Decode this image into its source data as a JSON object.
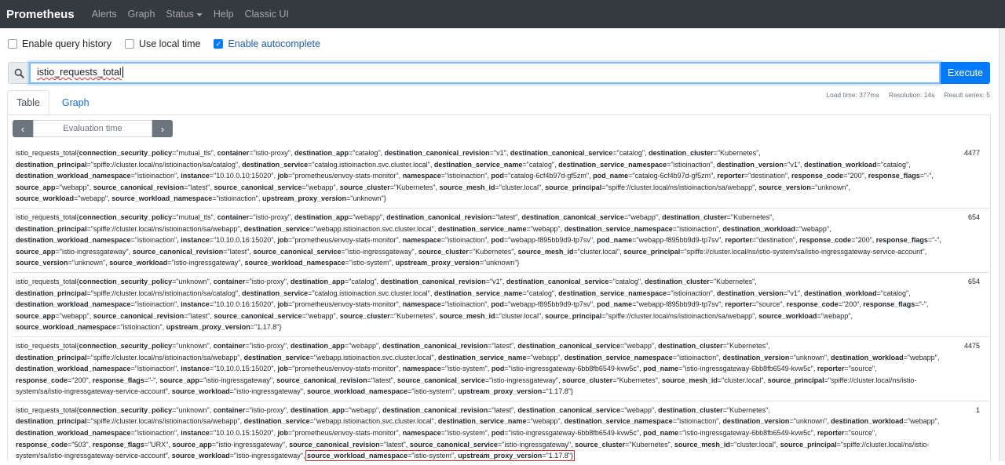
{
  "nav": {
    "brand": "Prometheus",
    "items": [
      "Alerts",
      "Graph",
      "Status",
      "Help",
      "Classic UI"
    ]
  },
  "options": {
    "query_history": "Enable query history",
    "local_time": "Use local time",
    "autocomplete": "Enable autocomplete"
  },
  "query": {
    "value": "istio_requests_total",
    "execute_label": "Execute"
  },
  "tabs": {
    "table": "Table",
    "graph": "Graph"
  },
  "stats": {
    "load_time": "Load time: 377ms",
    "resolution": "Resolution: 14s",
    "series": "Result series: 5"
  },
  "eval": {
    "label": "Evaluation time"
  },
  "results": [
    {
      "name": "istio_requests_total",
      "value": "4477",
      "labels": [
        [
          "connection_security_policy",
          "mutual_tls"
        ],
        [
          "container",
          "istio-proxy"
        ],
        [
          "destination_app",
          "catalog"
        ],
        [
          "destination_canonical_revision",
          "v1"
        ],
        [
          "destination_canonical_service",
          "catalog"
        ],
        [
          "destination_cluster",
          "Kubernetes"
        ],
        [
          "destination_principal",
          "spiffe://cluster.local/ns/istioinaction/sa/catalog"
        ],
        [
          "destination_service",
          "catalog.istioinaction.svc.cluster.local"
        ],
        [
          "destination_service_name",
          "catalog"
        ],
        [
          "destination_service_namespace",
          "istioinaction"
        ],
        [
          "destination_version",
          "v1"
        ],
        [
          "destination_workload",
          "catalog"
        ],
        [
          "destination_workload_namespace",
          "istioinaction"
        ],
        [
          "instance",
          "10.10.0.10:15020"
        ],
        [
          "job",
          "prometheus/envoy-stats-monitor"
        ],
        [
          "namespace",
          "istioinaction"
        ],
        [
          "pod",
          "catalog-6cf4b97d-gf5zm"
        ],
        [
          "pod_name",
          "catalog-6cf4b97d-gf5zm"
        ],
        [
          "reporter",
          "destination"
        ],
        [
          "response_code",
          "200"
        ],
        [
          "response_flags",
          "-"
        ],
        [
          "source_app",
          "webapp"
        ],
        [
          "source_canonical_revision",
          "latest"
        ],
        [
          "source_canonical_service",
          "webapp"
        ],
        [
          "source_cluster",
          "Kubernetes"
        ],
        [
          "source_mesh_id",
          "cluster.local"
        ],
        [
          "source_principal",
          "spiffe://cluster.local/ns/istioinaction/sa/webapp"
        ],
        [
          "source_version",
          "unknown"
        ],
        [
          "source_workload",
          "webapp"
        ],
        [
          "source_workload_namespace",
          "istioinaction"
        ],
        [
          "upstream_proxy_version",
          "unknown"
        ]
      ]
    },
    {
      "name": "istio_requests_total",
      "value": "654",
      "labels": [
        [
          "connection_security_policy",
          "mutual_tls"
        ],
        [
          "container",
          "istio-proxy"
        ],
        [
          "destination_app",
          "webapp"
        ],
        [
          "destination_canonical_revision",
          "latest"
        ],
        [
          "destination_canonical_service",
          "webapp"
        ],
        [
          "destination_cluster",
          "Kubernetes"
        ],
        [
          "destination_principal",
          "spiffe://cluster.local/ns/istioinaction/sa/webapp"
        ],
        [
          "destination_service",
          "webapp.istioinaction.svc.cluster.local"
        ],
        [
          "destination_service_name",
          "webapp"
        ],
        [
          "destination_service_namespace",
          "istioinaction"
        ],
        [
          "destination_workload",
          "webapp"
        ],
        [
          "destination_workload_namespace",
          "istioinaction"
        ],
        [
          "instance",
          "10.10.0.16:15020"
        ],
        [
          "job",
          "prometheus/envoy-stats-monitor"
        ],
        [
          "namespace",
          "istioinaction"
        ],
        [
          "pod",
          "webapp-f895bb9d9-tp7sv"
        ],
        [
          "pod_name",
          "webapp-f895bb9d9-tp7sv"
        ],
        [
          "reporter",
          "destination"
        ],
        [
          "response_code",
          "200"
        ],
        [
          "response_flags",
          "-"
        ],
        [
          "source_app",
          "istio-ingressgateway"
        ],
        [
          "source_canonical_revision",
          "latest"
        ],
        [
          "source_canonical_service",
          "istio-ingressgateway"
        ],
        [
          "source_cluster",
          "Kubernetes"
        ],
        [
          "source_mesh_id",
          "cluster.local"
        ],
        [
          "source_principal",
          "spiffe://cluster.local/ns/istio-system/sa/istio-ingressgateway-service-account"
        ],
        [
          "source_version",
          "unknown"
        ],
        [
          "source_workload",
          "istio-ingressgateway"
        ],
        [
          "source_workload_namespace",
          "istio-system"
        ],
        [
          "upstream_proxy_version",
          "unknown"
        ]
      ]
    },
    {
      "name": "istio_requests_total",
      "value": "654",
      "labels": [
        [
          "connection_security_policy",
          "unknown"
        ],
        [
          "container",
          "istio-proxy"
        ],
        [
          "destination_app",
          "catalog"
        ],
        [
          "destination_canonical_revision",
          "v1"
        ],
        [
          "destination_canonical_service",
          "catalog"
        ],
        [
          "destination_cluster",
          "Kubernetes"
        ],
        [
          "destination_principal",
          "spiffe://cluster.local/ns/istioinaction/sa/catalog"
        ],
        [
          "destination_service",
          "catalog.istioinaction.svc.cluster.local"
        ],
        [
          "destination_service_name",
          "catalog"
        ],
        [
          "destination_service_namespace",
          "istioinaction"
        ],
        [
          "destination_version",
          "v1"
        ],
        [
          "destination_workload",
          "catalog"
        ],
        [
          "destination_workload_namespace",
          "istioinaction"
        ],
        [
          "instance",
          "10.10.0.16:15020"
        ],
        [
          "job",
          "prometheus/envoy-stats-monitor"
        ],
        [
          "namespace",
          "istioinaction"
        ],
        [
          "pod",
          "webapp-f895bb9d9-tp7sv"
        ],
        [
          "pod_name",
          "webapp-f895bb9d9-tp7sv"
        ],
        [
          "reporter",
          "source"
        ],
        [
          "response_code",
          "200"
        ],
        [
          "response_flags",
          "-"
        ],
        [
          "source_app",
          "webapp"
        ],
        [
          "source_canonical_revision",
          "latest"
        ],
        [
          "source_canonical_service",
          "webapp"
        ],
        [
          "source_cluster",
          "Kubernetes"
        ],
        [
          "source_mesh_id",
          "cluster.local"
        ],
        [
          "source_principal",
          "spiffe://cluster.local/ns/istioinaction/sa/webapp"
        ],
        [
          "source_workload",
          "webapp"
        ],
        [
          "source_workload_namespace",
          "istioinaction"
        ],
        [
          "upstream_proxy_version",
          "1.17.8"
        ]
      ]
    },
    {
      "name": "istio_requests_total",
      "value": "4475",
      "labels": [
        [
          "connection_security_policy",
          "unknown"
        ],
        [
          "container",
          "istio-proxy"
        ],
        [
          "destination_app",
          "webapp"
        ],
        [
          "destination_canonical_revision",
          "latest"
        ],
        [
          "destination_canonical_service",
          "webapp"
        ],
        [
          "destination_cluster",
          "Kubernetes"
        ],
        [
          "destination_principal",
          "spiffe://cluster.local/ns/istioinaction/sa/webapp"
        ],
        [
          "destination_service",
          "webapp.istioinaction.svc.cluster.local"
        ],
        [
          "destination_service_name",
          "webapp"
        ],
        [
          "destination_service_namespace",
          "istioinaction"
        ],
        [
          "destination_version",
          "unknown"
        ],
        [
          "destination_workload",
          "webapp"
        ],
        [
          "destination_workload_namespace",
          "istioinaction"
        ],
        [
          "instance",
          "10.10.0.15:15020"
        ],
        [
          "job",
          "prometheus/envoy-stats-monitor"
        ],
        [
          "namespace",
          "istio-system"
        ],
        [
          "pod",
          "istio-ingressgateway-6bb8fb6549-kvw5c"
        ],
        [
          "pod_name",
          "istio-ingressgateway-6bb8fb6549-kvw5c"
        ],
        [
          "reporter",
          "source"
        ],
        [
          "response_code",
          "200"
        ],
        [
          "response_flags",
          "-"
        ],
        [
          "source_app",
          "istio-ingressgateway"
        ],
        [
          "source_canonical_revision",
          "latest"
        ],
        [
          "source_canonical_service",
          "istio-ingressgateway"
        ],
        [
          "source_cluster",
          "Kubernetes"
        ],
        [
          "source_mesh_id",
          "cluster.local"
        ],
        [
          "source_principal",
          "spiffe://cluster.local/ns/istio-system/sa/istio-ingressgateway-service-account"
        ],
        [
          "source_workload",
          "istio-ingressgateway"
        ],
        [
          "source_workload_namespace",
          "istio-system"
        ],
        [
          "upstream_proxy_version",
          "1.17.8"
        ]
      ]
    },
    {
      "name": "istio_requests_total",
      "value": "1",
      "labels": [
        [
          "connection_security_policy",
          "unknown"
        ],
        [
          "container",
          "istio-proxy"
        ],
        [
          "destination_app",
          "webapp"
        ],
        [
          "destination_canonical_revision",
          "latest"
        ],
        [
          "destination_canonical_service",
          "webapp"
        ],
        [
          "destination_cluster",
          "Kubernetes"
        ],
        [
          "destination_principal",
          "spiffe://cluster.local/ns/istioinaction/sa/webapp"
        ],
        [
          "destination_service",
          "webapp.istioinaction.svc.cluster.local"
        ],
        [
          "destination_service_name",
          "webapp"
        ],
        [
          "destination_service_namespace",
          "istioinaction"
        ],
        [
          "destination_version",
          "unknown"
        ],
        [
          "destination_workload",
          "webapp"
        ],
        [
          "destination_workload_namespace",
          "istioinaction"
        ],
        [
          "instance",
          "10.10.0.15:15020"
        ],
        [
          "job",
          "prometheus/envoy-stats-monitor"
        ],
        [
          "namespace",
          "istio-system"
        ],
        [
          "pod",
          "istio-ingressgateway-6bb8fb6549-kvw5c"
        ],
        [
          "pod_name",
          "istio-ingressgateway-6bb8fb6549-kvw5c"
        ],
        [
          "reporter",
          "source"
        ],
        [
          "response_code",
          "503"
        ],
        [
          "response_flags",
          "URX"
        ],
        [
          "source_app",
          "istio-ingressgateway"
        ],
        [
          "source_canonical_revision",
          "latest"
        ],
        [
          "source_canonical_service",
          "istio-ingressgateway"
        ],
        [
          "source_cluster",
          "Kubernetes"
        ],
        [
          "source_mesh_id",
          "cluster.local"
        ],
        [
          "source_principal",
          "spiffe://cluster.local/ns/istio-system/sa/istio-ingressgateway-service-account"
        ],
        [
          "source_workload",
          "istio-ingressgateway"
        ],
        [
          "source_workload_namespace",
          "istio-system"
        ],
        [
          "upstream_proxy_version",
          "1.17.8"
        ]
      ],
      "highlight_from": "source_workload_namespace"
    }
  ]
}
